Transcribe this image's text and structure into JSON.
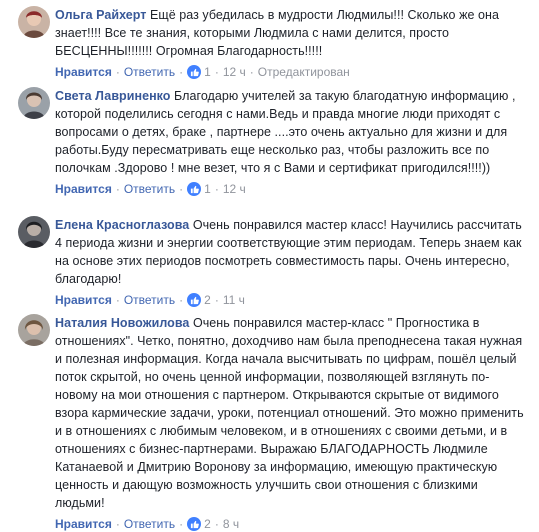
{
  "comments": [
    {
      "author": "Ольга Райхерт",
      "text": "Ещё раз убедилась в мудрости Людмилы!!! Сколько же она знает!!!! Все те знания, которыми Людмила с нами делится, просто БЕСЦЕННЫ!!!!!!! Огромная Благодарность!!!!!",
      "like_label": "Нравится",
      "reply_label": "Ответить",
      "likes": "1",
      "time": "12 ч",
      "edited": "Отредактирован",
      "avatar_icon": "user-photo"
    },
    {
      "author": "Света Лавриненко",
      "text": "Благодарю учителей за такую благодатную информацию , которой поделились сегодня с нами.Ведь и правда многие люди приходят с вопросами о детях, браке , партнере ....это очень актуально для жизни и для работы.Буду пересматривать еще несколько раз, чтобы разложить все по полочкам .Здорово ! мне везет, что я с Вами и сертификат пригодился!!!!))",
      "like_label": "Нравится",
      "reply_label": "Ответить",
      "likes": "1",
      "time": "12 ч",
      "edited": "",
      "avatar_icon": "user-photo"
    },
    {
      "author": "Елена Красноглазова",
      "text": "Очень понравился мастер класс! Научились рассчитать 4 периода жизни и энергии соответствующие этим периодам. Теперь знаем как на основе этих периодов посмотреть совместимость пары. Очень интересно, благодарю!",
      "like_label": "Нравится",
      "reply_label": "Ответить",
      "likes": "2",
      "time": "11 ч",
      "edited": "",
      "avatar_icon": "user-photo"
    },
    {
      "author": "Наталия Новожилова",
      "text": "Очень понравился мастер-класс \" Прогностика в отношениях\". Четко, понятно, доходчиво нам была преподнесена такая нужная и полезная информация. Когда начала высчитывать по цифрам, пошёл целый поток скрытой, но очень ценной информации, позволяющей взглянуть по-новому на мои отношения с партнером. Открываются скрытые от видимого взора кармические задачи, уроки, потенциал отношений. Это можно применить и в отношениях с любимым человеком, и в отношениях с своими детьми, и в отношениях с бизнес-партнерами. Выражаю БЛАГОДАРНОСТЬ Людмиле Катанаевой и Дмитрию Воронову за информацию, имеющую практическую ценность и дающую возможность улучшить свои отношения с близкими людьми!",
      "like_label": "Нравится",
      "reply_label": "Ответить",
      "likes": "2",
      "time": "8 ч",
      "edited": "",
      "avatar_icon": "user-photo"
    }
  ]
}
